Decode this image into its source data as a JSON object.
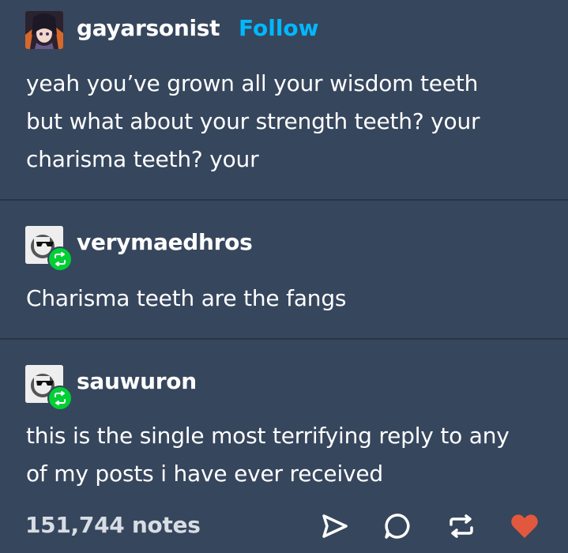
{
  "op": {
    "username": "gayarsonist",
    "follow_label": "Follow",
    "text_lines": [
      "yeah you’ve grown all your wisdom teeth",
      "but what about your strength teeth? your",
      "charisma teeth? your"
    ]
  },
  "reblogs": [
    {
      "username": "verymaedhros",
      "avatar_icon": "sunglasses-avatar-icon",
      "text_lines": [
        "Charisma teeth are the fangs"
      ]
    },
    {
      "username": "sauwuron",
      "avatar_icon": "sunglasses-avatar-icon",
      "text_lines": [
        "this is the single most terrifying reply to any",
        "of my posts i have ever received"
      ]
    }
  ],
  "footer": {
    "notes": "151,744 notes",
    "icons": [
      "share-icon",
      "reply-icon",
      "reblog-icon",
      "like-icon"
    ]
  },
  "colors": {
    "background": "#36465d",
    "follow": "#00b8ff",
    "reblog_badge": "#00cf35",
    "like": "#e2583e"
  }
}
